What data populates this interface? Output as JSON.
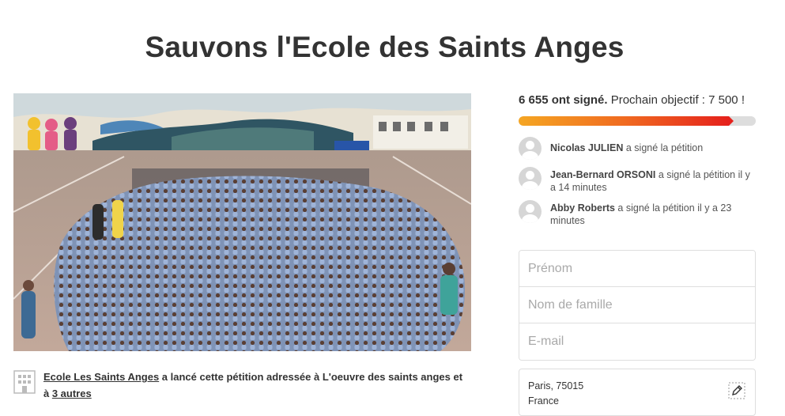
{
  "petition": {
    "title": "Sauvons l'Ecole des Saints Anges"
  },
  "photo": {
    "icon": "school-group-photo"
  },
  "starter": {
    "icon": "building-icon",
    "author": "Ecole Les Saints Anges",
    "text_middle": " a lancé cette pétition adressée à L'oeuvre des saints anges et à ",
    "others_link": "3 autres"
  },
  "signatures": {
    "count": "6 655 ont signé.",
    "goal_text": " Prochain objectif : 7 500 !",
    "progress": 0.887,
    "colors": {
      "start": "#f5a623",
      "end": "#e5211c",
      "track": "#dddddd"
    }
  },
  "recent_signers": [
    {
      "name": "Nicolas JULIEN",
      "action": " a signé la pétition"
    },
    {
      "name": "Jean-Bernard ORSONI",
      "action": " a signé la pétition il y a 14 minutes"
    },
    {
      "name": "Abby Roberts",
      "action": " a signé la pétition il y a 23 minutes"
    }
  ],
  "form": {
    "first_name_placeholder": "Prénom",
    "last_name_placeholder": "Nom de famille",
    "email_placeholder": "E-mail",
    "location_city": "Paris, 75015",
    "location_country": "France",
    "edit_icon": "pencil-icon"
  }
}
